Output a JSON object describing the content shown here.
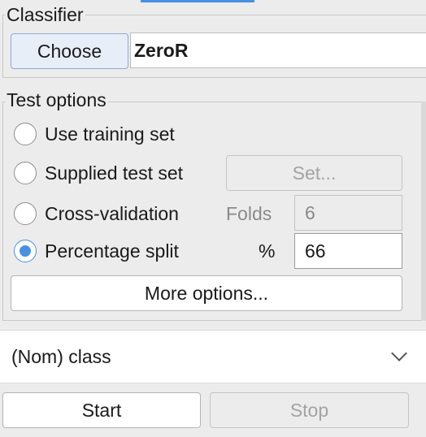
{
  "classifier": {
    "group_title": "Classifier",
    "choose_label": "Choose",
    "name": "ZeroR"
  },
  "test_options": {
    "group_title": "Test options",
    "use_training_label": "Use training set",
    "supplied_test_label": "Supplied test set",
    "set_button_label": "Set...",
    "cross_validation_label": "Cross-validation",
    "folds_label": "Folds",
    "folds_value": "6",
    "percentage_split_label": "Percentage split",
    "percent_symbol": "%",
    "percentage_value": "66",
    "more_options_label": "More options...",
    "selected_option": "percentage_split"
  },
  "class_select": {
    "value": "(Nom) class"
  },
  "actions": {
    "start_label": "Start",
    "stop_label": "Stop"
  },
  "colors": {
    "accent": "#4a90e2",
    "background": "#ececec"
  }
}
